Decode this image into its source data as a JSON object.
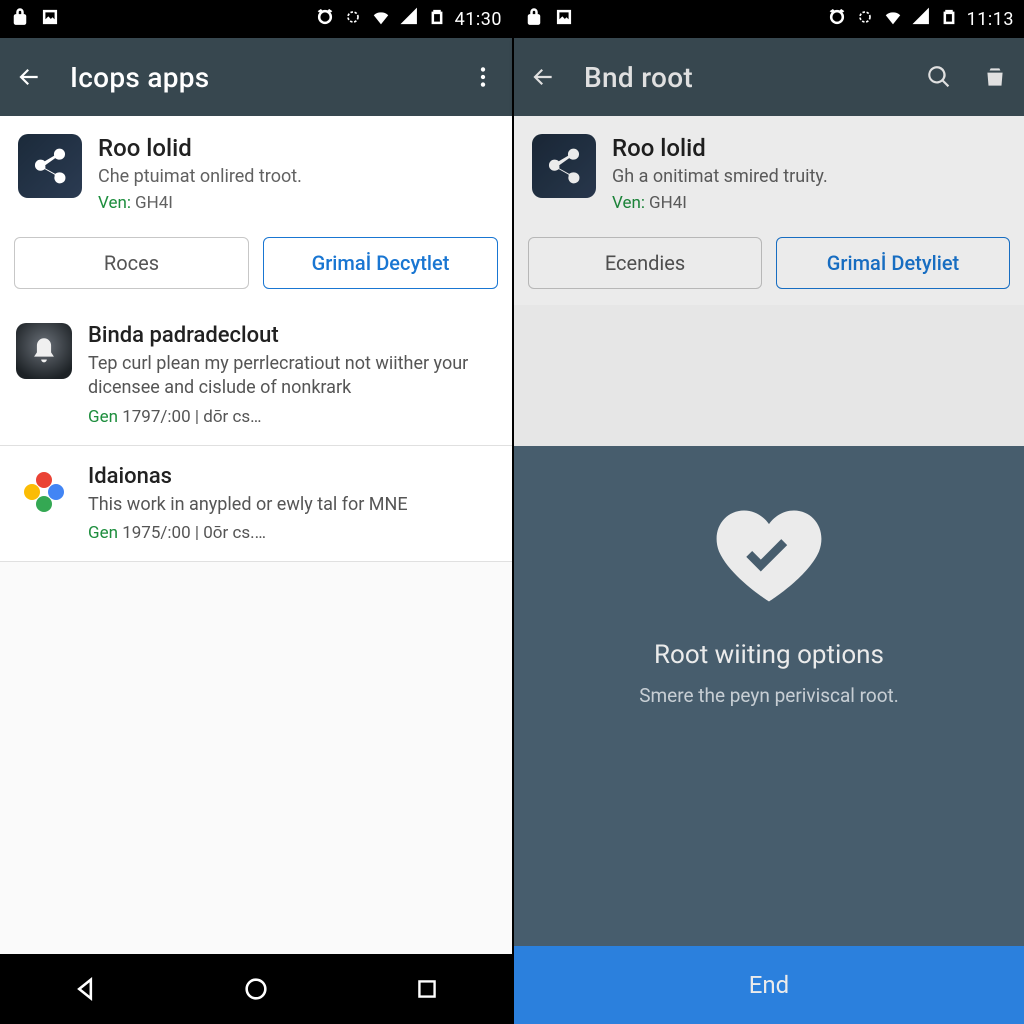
{
  "left": {
    "status": {
      "clock": "41:30"
    },
    "appbar": {
      "title": "Icops apps"
    },
    "card": {
      "name": "Roo lolid",
      "desc": "Che ptuimat onlired troot.",
      "ven_label": "Ven:",
      "ven_value": "GH4I"
    },
    "tabs": {
      "a": "Roces",
      "b": "Grimaİ Decytlet"
    },
    "items": [
      {
        "title": "Binda padradeclout",
        "desc": "Tep curl plean my perrlecratiout not wiither your dicensee and cislude of nonkrark",
        "meta_g": "Gen",
        "meta_rest": "1797/:00 | dōr cs…"
      },
      {
        "title": "Idaionas",
        "desc": "This work in anypled or ewly tal for MNE",
        "meta_g": "Gen",
        "meta_rest": "1975/:00 | 0ōr cs.…"
      }
    ]
  },
  "right": {
    "status": {
      "clock": "11:13"
    },
    "appbar": {
      "title": "Bnd root"
    },
    "card": {
      "name": "Roo lolid",
      "desc": "Gh a onitimat smired truity.",
      "ven_label": "Ven:",
      "ven_value": "GH4I"
    },
    "tabs": {
      "a": "Ecendies",
      "b": "Grimaİ Detyliet"
    },
    "overlay": {
      "title": "Root wiiting options",
      "sub": "Smere the peyn periviscal root.",
      "end": "End"
    }
  }
}
